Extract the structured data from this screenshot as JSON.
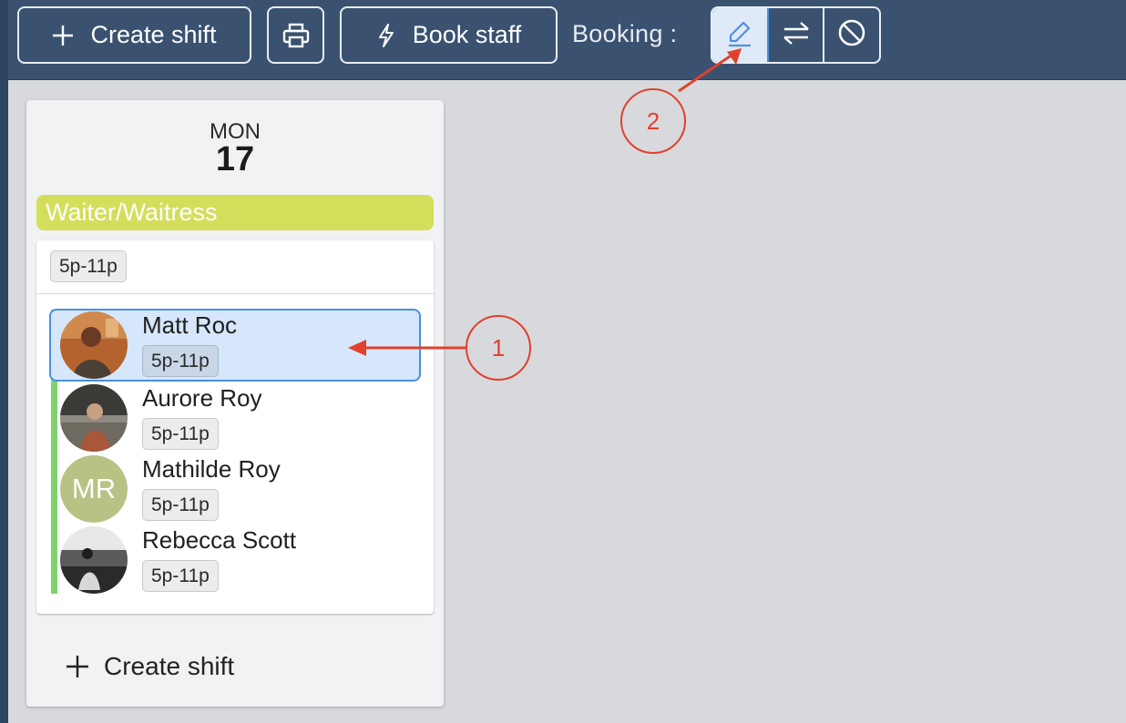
{
  "toolbar": {
    "create_shift_label": "Create shift",
    "book_staff_label": "Book staff",
    "booking_label": "Booking :",
    "booking_modes": [
      {
        "icon": "pencil-icon",
        "active": true
      },
      {
        "icon": "swap-arrows-icon",
        "active": false
      },
      {
        "icon": "block-icon",
        "active": false
      }
    ]
  },
  "day": {
    "name": "MON",
    "number": "17",
    "role": "Waiter/Waitress",
    "shift_time": "5p-11p",
    "staff": [
      {
        "name": "Matt Roc",
        "time": "5p-11p",
        "avatar": "photo",
        "selected": true
      },
      {
        "name": "Aurore Roy",
        "time": "5p-11p",
        "avatar": "photo",
        "selected": false
      },
      {
        "name": "Mathilde Roy",
        "time": "5p-11p",
        "avatar": "MR",
        "selected": false
      },
      {
        "name": "Rebecca Scott",
        "time": "5p-11p",
        "avatar": "photo",
        "selected": false
      }
    ],
    "create_shift_label": "Create shift"
  },
  "annotations": {
    "one": "1",
    "two": "2"
  },
  "colors": {
    "topbar": "#3a5270",
    "role_bar": "#d3de5b",
    "selected_row": "#d6e6fb",
    "accent_blue": "#4a90e2",
    "green_line": "#7ed36c",
    "annotation_red": "#e0412c"
  }
}
